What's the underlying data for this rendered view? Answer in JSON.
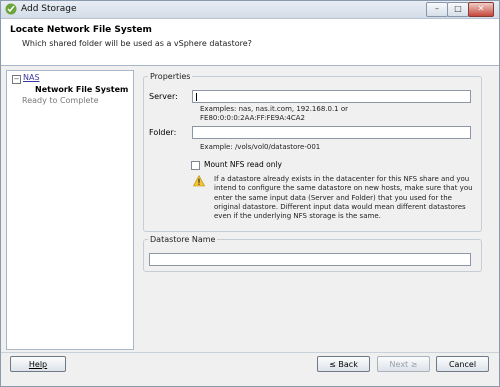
{
  "window": {
    "title": "Add Storage",
    "icon": "vsphere-storage-icon",
    "controls": [
      "minimize",
      "maximize",
      "close"
    ]
  },
  "header": {
    "title": "Locate Network File System",
    "subtitle": "Which shared folder will be used as a vSphere datastore?"
  },
  "nav": {
    "items": [
      {
        "label": "NAS",
        "state": "link"
      },
      {
        "label": "Network File System",
        "state": "current"
      },
      {
        "label": "Ready to Complete",
        "state": "disabled"
      }
    ]
  },
  "properties": {
    "legend": "Properties",
    "server_label": "Server:",
    "server_value": "",
    "server_hint_line1": "Examples: nas, nas.it.com, 192.168.0.1 or",
    "server_hint_line2": "FE80:0:0:0:2AA:FF:FE9A:4CA2",
    "folder_label": "Folder:",
    "folder_value": "",
    "folder_hint": "Example: /vols/vol0/datastore-001",
    "readonly_label": "Mount NFS read only",
    "readonly_checked": false,
    "warning_text": "If a datastore already exists in the datacenter for this NFS share and you intend to configure the same datastore on new hosts, make sure that you enter the same input data (Server and Folder) that you used for the original datastore. Different input data would mean different datastores even if the underlying NFS storage is the same."
  },
  "datastore": {
    "legend": "Datastore Name",
    "value": ""
  },
  "footer": {
    "help_label": "Help",
    "back_label": "≤ Back",
    "next_label": "Next ≥",
    "cancel_label": "Cancel",
    "next_enabled": false
  }
}
